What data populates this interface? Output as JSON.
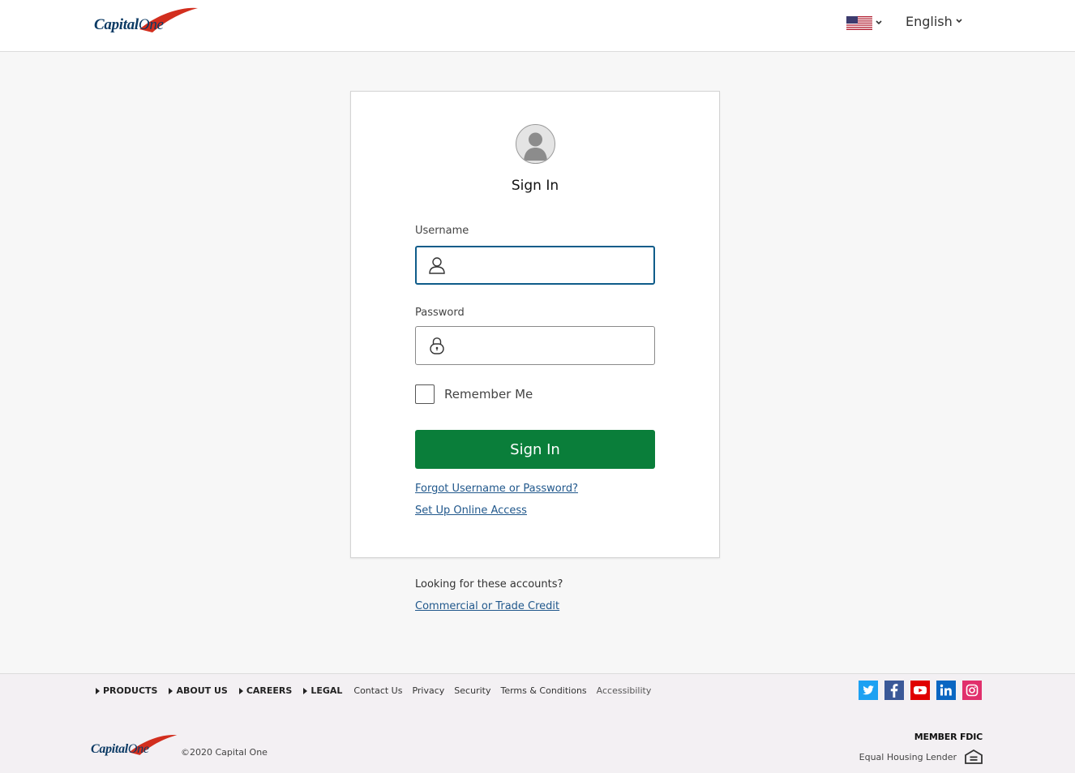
{
  "header": {
    "logo_text_bold": "Capital",
    "logo_text_one": "One",
    "flag_icon": "us-flag-icon",
    "language": "English"
  },
  "card": {
    "avatar_icon": "user-avatar-icon",
    "title": "Sign In",
    "username_label": "Username",
    "username_value": "",
    "password_label": "Password",
    "password_value": "",
    "remember_label": "Remember Me",
    "remember_checked": false,
    "signin_button": "Sign In",
    "forgot_link": "Forgot Username or Password?",
    "setup_link": "Set Up Online Access"
  },
  "below_card": {
    "looking_text": "Looking for these accounts?",
    "commercial_link": "Commercial or Trade Credit"
  },
  "footer": {
    "nav_categories": [
      "PRODUCTS",
      "ABOUT US",
      "CAREERS",
      "LEGAL"
    ],
    "nav_links": [
      "Contact Us",
      "Privacy",
      "Security",
      "Terms & Conditions",
      "Accessibility"
    ],
    "social": [
      {
        "name": "twitter-icon",
        "color": "#1da1f2"
      },
      {
        "name": "facebook-icon",
        "color": "#3b5998"
      },
      {
        "name": "youtube-icon",
        "color": "#e00000"
      },
      {
        "name": "linkedin-icon",
        "color": "#0a66c2"
      },
      {
        "name": "instagram-icon",
        "color": "#e1306c"
      }
    ],
    "copyright": "©2020 Capital One",
    "member_fdic": "MEMBER FDIC",
    "equal_housing": "Equal Housing Lender",
    "equal_housing_icon": "equal-housing-icon"
  },
  "colors": {
    "brand_navy": "#0b3a64",
    "brand_red": "#d22e1e",
    "signin_green": "#0a7e3a",
    "link_blue": "#21588c",
    "focus_border": "#0f5c8a"
  }
}
